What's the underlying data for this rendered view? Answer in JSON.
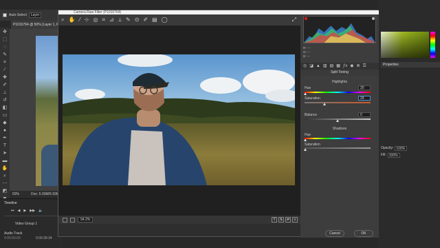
{
  "options_bar": {
    "auto_select_label": "Auto-Select",
    "layer_select": "Layer"
  },
  "document": {
    "tab_title": "P1010764 @ 50% (Layer 1, RGB/8)",
    "zoom": "50%",
    "doc_size": "Doc: 5.93M/5.93M"
  },
  "timeline": {
    "title": "Timeline",
    "timecode": "0:00:00:00",
    "video_group": "Video Group 1",
    "audio_track": "Audio Track",
    "end_time": "0:00:28:34"
  },
  "right_panels": {
    "tab_label": "Properties",
    "opacity_label": "Opacity:",
    "opacity_value": "100%",
    "fill_label": "Fill:",
    "fill_value": "100%"
  },
  "dialog": {
    "title": "Camera Raw Filter (P1010764)",
    "zoom_level": "94.2%",
    "readout": {
      "r": "R:",
      "g": "G:",
      "b": "B:",
      "r_val": "---",
      "g_val": "---",
      "b_val": "---"
    },
    "panel_title": "Split Toning",
    "highlights": {
      "label": "Highlights",
      "hue_label": "Hue",
      "hue_value": "20",
      "saturation_label": "Saturation",
      "saturation_value": "29"
    },
    "balance": {
      "label": "Balance",
      "value": "0"
    },
    "shadows": {
      "label": "Shadows",
      "hue_label": "Hue",
      "hue_value": "0",
      "saturation_label": "Saturation",
      "saturation_value": "0"
    },
    "cancel_label": "Cancel",
    "ok_label": "OK"
  }
}
